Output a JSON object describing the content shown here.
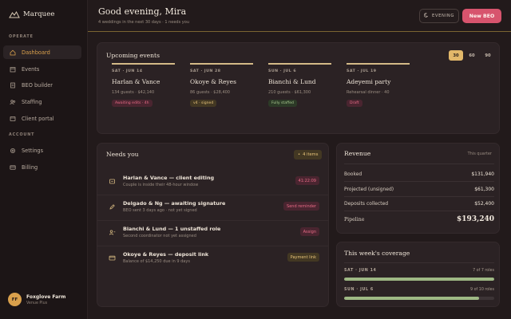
{
  "brand": {
    "name": "Marquee"
  },
  "sidebar": {
    "operate_label": "OPERATE",
    "account_label": "ACCOUNT",
    "operate_items": [
      {
        "label": "Dashboard",
        "icon": "home-icon",
        "active": true
      },
      {
        "label": "Events",
        "icon": "calendar-icon"
      },
      {
        "label": "BEO builder",
        "icon": "document-icon"
      },
      {
        "label": "Staffing",
        "icon": "users-icon"
      },
      {
        "label": "Client portal",
        "icon": "portal-icon"
      }
    ],
    "account_items": [
      {
        "label": "Settings",
        "icon": "gear-icon"
      },
      {
        "label": "Billing",
        "icon": "card-icon"
      }
    ],
    "user": {
      "initials": "FF",
      "name": "Foxglove Farm",
      "plan": "Venue Plus"
    }
  },
  "header": {
    "greeting": "Good evening, Mira",
    "subtitle": "4 weddings in the next 30 days · 1 needs you",
    "evening_label": "EVENING",
    "new_beo_label": "New BEO"
  },
  "upcoming": {
    "title": "Upcoming events",
    "ranges": [
      "30",
      "60",
      "90"
    ],
    "selected_range": "30",
    "events": [
      {
        "date": "SAT · JUN 14",
        "name": "Harlan & Vance",
        "meta": "134 guests · $42,140",
        "status": "Awaiting edits · 4h",
        "status_color": "red"
      },
      {
        "date": "SAT · JUN 28",
        "name": "Okoye & Reyes",
        "meta": "86 guests · $28,400",
        "status": "v4 · signed",
        "status_color": "gold"
      },
      {
        "date": "SUN · JUL 6",
        "name": "Bianchi & Lund",
        "meta": "210 guests · $61,300",
        "status": "Fully staffed",
        "status_color": "green"
      },
      {
        "date": "SAT · JUL 19",
        "name": "Adeyemi party",
        "meta": "Rehearsal dinner · 40",
        "status": "Draft",
        "status_color": "red"
      }
    ]
  },
  "needs": {
    "title": "Needs you",
    "count_label": "4 items",
    "items": [
      {
        "icon": "document-icon",
        "title": "Harlan & Vance — client editing",
        "sub": "Couple is inside their 48-hour window",
        "action": "41:22:09",
        "action_color": "red"
      },
      {
        "icon": "pen-icon",
        "title": "Delgado & Ng — awaiting signature",
        "sub": "BEO sent 3 days ago · not yet signed",
        "action": "Send reminder",
        "action_color": "red"
      },
      {
        "icon": "staff-icon",
        "title": "Bianchi & Lund — 1 unstaffed role",
        "sub": "Second coordinator not yet assigned",
        "action": "Assign",
        "action_color": "red"
      },
      {
        "icon": "card-icon",
        "title": "Okoye & Reyes — deposit link",
        "sub": "Balance of $14,250 due in 9 days",
        "action": "Payment link",
        "action_color": "gold"
      }
    ]
  },
  "revenue": {
    "title": "Revenue",
    "period": "This quarter",
    "rows": [
      {
        "label": "Booked",
        "value": "$131,940"
      },
      {
        "label": "Projected (unsigned)",
        "value": "$61,300"
      },
      {
        "label": "Deposits collected",
        "value": "$52,400"
      }
    ],
    "pipeline_label": "Pipeline",
    "pipeline_value": "$193,240"
  },
  "coverage": {
    "title": "This week's coverage",
    "rows": [
      {
        "date": "SAT · JUN 14",
        "roles": "7 of 7 roles",
        "fraction": 1.0
      },
      {
        "date": "SUN · JUL 6",
        "roles": "9 of 10 roles",
        "fraction": 0.9
      }
    ]
  },
  "colors": {
    "accent": "#d9a04c",
    "primary_button": "#d7546d",
    "bar_fill": "#9eb884",
    "background": "#221a1b"
  }
}
